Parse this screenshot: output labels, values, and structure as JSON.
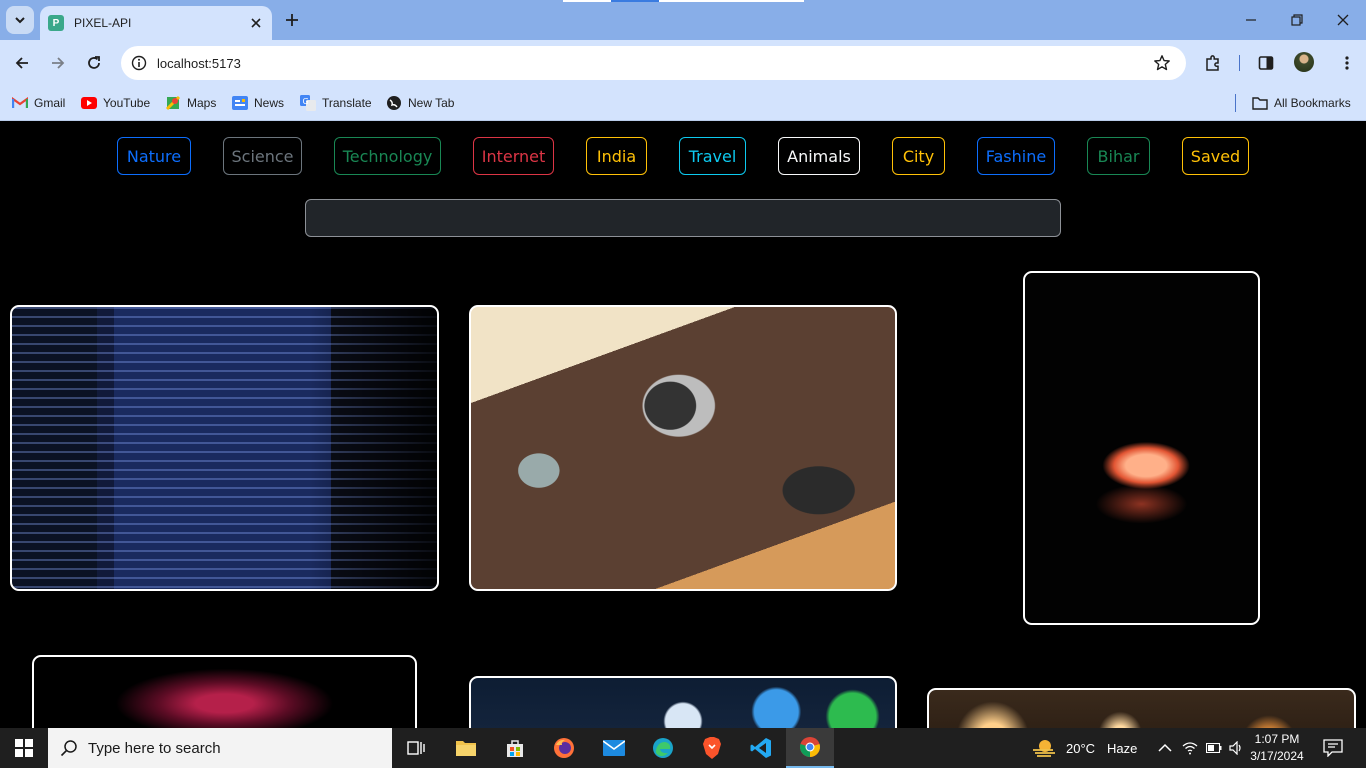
{
  "browser": {
    "tab": {
      "title": "PIXEL-API",
      "favicon_letter": "P"
    },
    "address": "localhost:5173",
    "bookmarks": [
      {
        "label": "Gmail",
        "icon": "gmail-icon"
      },
      {
        "label": "YouTube",
        "icon": "youtube-icon"
      },
      {
        "label": "Maps",
        "icon": "maps-icon"
      },
      {
        "label": "News",
        "icon": "news-icon"
      },
      {
        "label": "Translate",
        "icon": "translate-icon"
      },
      {
        "label": "New Tab",
        "icon": "globe-icon"
      }
    ],
    "all_bookmarks_label": "All Bookmarks"
  },
  "page": {
    "categories": [
      {
        "label": "Nature",
        "color": "#0d6efd"
      },
      {
        "label": "Science",
        "color": "#6c757d"
      },
      {
        "label": "Technology",
        "color": "#198754"
      },
      {
        "label": "Internet",
        "color": "#dc3545"
      },
      {
        "label": "India",
        "color": "#ffc107"
      },
      {
        "label": "Travel",
        "color": "#0dcaf0"
      },
      {
        "label": "Animals",
        "color": "#f8f9fa"
      },
      {
        "label": "City",
        "color": "#ffc107"
      },
      {
        "label": "Fashine",
        "color": "#0d6efd"
      },
      {
        "label": "Bihar",
        "color": "#198754"
      },
      {
        "label": "Saved",
        "color": "#ffc107"
      }
    ],
    "search": {
      "value": "",
      "placeholder": ""
    },
    "images": [
      {
        "subject": "code-on-laptop-screen"
      },
      {
        "subject": "workspace-desk-top-view"
      },
      {
        "subject": "glowing-laptop-in-dark"
      },
      {
        "subject": "plasma-ball"
      },
      {
        "subject": "phone-app-icons"
      },
      {
        "subject": "city-lights"
      }
    ]
  },
  "taskbar": {
    "search_placeholder": "Type here to search",
    "weather": {
      "temp": "20°C",
      "condition": "Haze"
    },
    "time": "1:07 PM",
    "date": "3/17/2024"
  }
}
